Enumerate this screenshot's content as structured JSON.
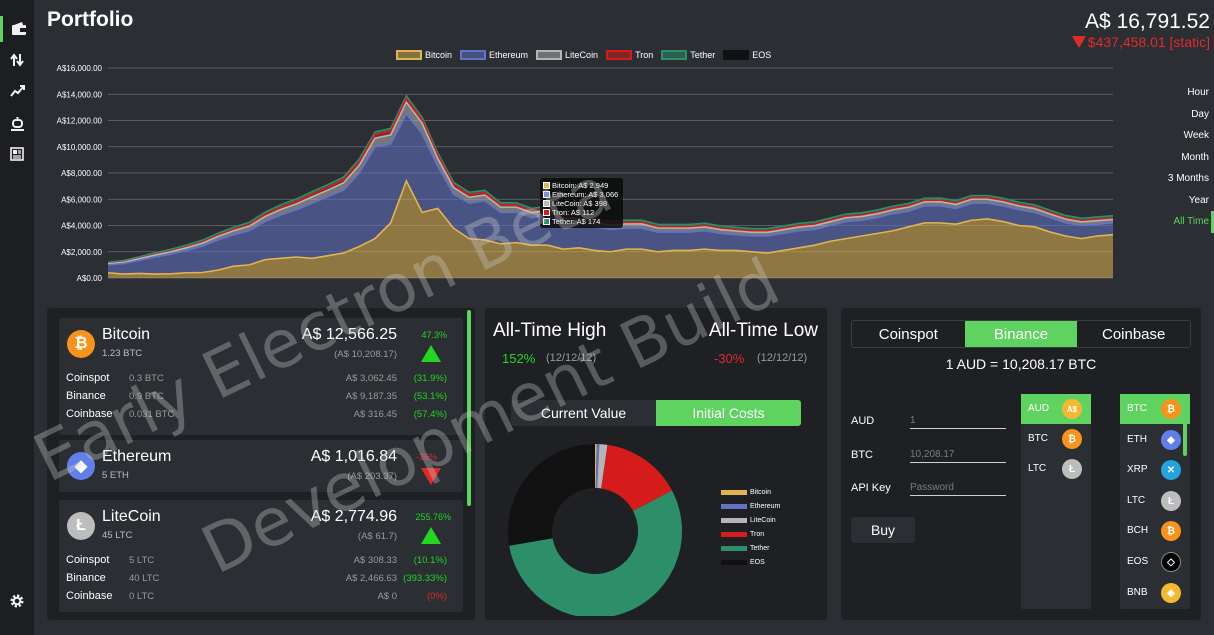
{
  "header": {
    "title": "Portfolio",
    "total_value": "A$ 16,791.52",
    "total_change": "$437,458.01 [static]"
  },
  "nav": {
    "items": [
      "wallet-icon",
      "transfer-icon",
      "trend-icon",
      "bot-icon",
      "news-icon"
    ],
    "settings_icon": "gear-icon"
  },
  "chart_legend": [
    {
      "name": "Bitcoin",
      "color": "#e0b550"
    },
    {
      "name": "Ethereum",
      "color": "#6273c7"
    },
    {
      "name": "LiteCoin",
      "color": "#b5b5b5"
    },
    {
      "name": "Tron",
      "color": "#d61b1b"
    },
    {
      "name": "Tether",
      "color": "#2d8f6a"
    },
    {
      "name": "EOS",
      "color": "#111111"
    }
  ],
  "chart_data": {
    "type": "area",
    "stacked": true,
    "yticks": [
      "A$0.00",
      "A$2,000.00",
      "A$4,000.00",
      "A$6,000.00",
      "A$8,000.00",
      "A$10,000.00",
      "A$12,000.00",
      "A$14,000.00",
      "A$16,000.00"
    ],
    "ylim": [
      0,
      16000
    ],
    "grid": true,
    "legend": "top-center",
    "series": [
      {
        "name": "Bitcoin",
        "values": [
          400,
          300,
          350,
          300,
          320,
          400,
          420,
          600,
          900,
          1000,
          1400,
          1500,
          1600,
          1500,
          1700,
          1900,
          2400,
          3000,
          4200,
          7400,
          5000,
          5300,
          3800,
          3000,
          2900,
          2600,
          2700,
          2500,
          2500,
          2200,
          2300,
          2100,
          2000,
          2200,
          2200,
          2000,
          2100,
          2100,
          2200,
          2100,
          2100,
          2000,
          1900,
          2100,
          2300,
          2500,
          2800,
          3000,
          3200,
          3400,
          3600,
          3900,
          4200,
          4200,
          4100,
          4400,
          4500,
          4300,
          4000,
          3900,
          3500,
          3200,
          3000,
          3200,
          3300
        ]
      },
      {
        "name": "Ethereum",
        "values": [
          600,
          800,
          1000,
          1300,
          1500,
          1700,
          2000,
          2300,
          2400,
          2600,
          2900,
          3300,
          3600,
          4200,
          4500,
          4800,
          5600,
          7000,
          6000,
          5100,
          6000,
          3200,
          2600,
          2700,
          3000,
          2400,
          2300,
          2100,
          2300,
          2000,
          1900,
          1800,
          1700,
          1600,
          1600,
          1500,
          1400,
          1400,
          1400,
          1300,
          1200,
          1200,
          1300,
          1300,
          1300,
          1200,
          1200,
          1300,
          1200,
          1200,
          1300,
          1200,
          1300,
          1300,
          1200,
          1300,
          1200,
          1200,
          1200,
          1100,
          1100,
          1000,
          1000,
          900,
          900
        ]
      },
      {
        "name": "LiteCoin",
        "values": [
          80,
          100,
          120,
          150,
          180,
          200,
          230,
          260,
          300,
          350,
          380,
          420,
          450,
          480,
          500,
          550,
          600,
          650,
          700,
          900,
          800,
          600,
          500,
          450,
          420,
          400,
          400,
          380,
          380,
          360,
          350,
          340,
          330,
          320,
          320,
          310,
          300,
          300,
          290,
          290,
          280,
          280,
          280,
          280,
          280,
          290,
          290,
          290,
          290,
          300,
          300,
          300,
          300,
          310,
          310,
          300,
          300,
          300,
          290,
          290,
          280,
          280,
          270,
          270,
          260
        ]
      },
      {
        "name": "Tron",
        "values": [
          20,
          30,
          40,
          50,
          60,
          70,
          80,
          90,
          100,
          120,
          140,
          160,
          180,
          200,
          220,
          240,
          260,
          280,
          300,
          280,
          260,
          240,
          220,
          200,
          180,
          160,
          150,
          140,
          130,
          120,
          110,
          110,
          110,
          110,
          110,
          110,
          110,
          110,
          110,
          110,
          110,
          110,
          110,
          110,
          110,
          110,
          110,
          110,
          110,
          110,
          110,
          110,
          110,
          110,
          110,
          110,
          110,
          110,
          110,
          110,
          110,
          110,
          110,
          110,
          110
        ]
      },
      {
        "name": "Tether",
        "values": [
          100,
          110,
          110,
          120,
          130,
          140,
          150,
          160,
          170,
          180,
          190,
          200,
          200,
          200,
          200,
          200,
          200,
          200,
          200,
          200,
          190,
          190,
          180,
          180,
          180,
          180,
          180,
          180,
          175,
          175,
          175,
          175,
          175,
          175,
          175,
          175,
          175,
          175,
          175,
          175,
          175,
          175,
          175,
          175,
          175,
          175,
          175,
          175,
          175,
          175,
          175,
          175,
          175,
          175,
          175,
          175,
          175,
          175,
          175,
          175,
          175,
          175,
          175,
          175,
          175
        ]
      },
      {
        "name": "EOS",
        "values": [
          0,
          0,
          0,
          0,
          0,
          0,
          0,
          0,
          0,
          0,
          0,
          0,
          0,
          0,
          0,
          0,
          0,
          0,
          0,
          0,
          0,
          0,
          0,
          0,
          0,
          0,
          0,
          0,
          0,
          0,
          0,
          0,
          0,
          0,
          0,
          0,
          0,
          0,
          0,
          0,
          0,
          0,
          0,
          0,
          0,
          0,
          0,
          0,
          0,
          0,
          0,
          0,
          0,
          0,
          0,
          0,
          0,
          0,
          0,
          0,
          0,
          0,
          0,
          0,
          0
        ]
      }
    ]
  },
  "tooltip": {
    "rows": [
      {
        "label": "Bitcoin: A$ 2,949",
        "color": "#e0b550"
      },
      {
        "label": "Ethereum: A$ 3,066",
        "color": "#6273c7"
      },
      {
        "label": "LiteCoin: A$ 398",
        "color": "#b5b5b5"
      },
      {
        "label": "Tron: A$ 112",
        "color": "#d61b1b"
      },
      {
        "label": "Tether: A$ 174",
        "color": "#2d8f6a"
      }
    ]
  },
  "ranges": [
    "Hour",
    "Day",
    "Week",
    "Month",
    "3 Months",
    "Year",
    "All Time"
  ],
  "holdings": {
    "coins": [
      {
        "name": "Bitcoin",
        "amount": "1.23 BTC",
        "value": "A$ 12,566.25",
        "sub": "(A$ 10,208.17)",
        "pct": "47.3%",
        "color": "#f7931a",
        "symbol": "₿",
        "exchanges": [
          {
            "name": "Coinspot",
            "amt": "0.3 BTC",
            "val": "A$ 3,062.45",
            "pct": "(31.9%)"
          },
          {
            "name": "Binance",
            "amt": "0.9 BTC",
            "val": "A$ 9,187.35",
            "pct": "(53.1%)"
          },
          {
            "name": "Coinbase",
            "amt": "0.031 BTC",
            "val": "A$ 316.45",
            "pct": "(57.4%)"
          }
        ]
      },
      {
        "name": "Ethereum",
        "amount": "5 ETH",
        "value": "A$ 1,016.84",
        "sub": "(A$ 203.37)",
        "pct": "-36%",
        "color": "#627eea",
        "symbol": "◆"
      },
      {
        "name": "LiteCoin",
        "amount": "45 LTC",
        "value": "A$ 2,774.96",
        "sub": "(A$ 61.7)",
        "pct": "255.76%",
        "color": "#bdbdbd",
        "symbol": "Ł",
        "exchanges": [
          {
            "name": "Coinspot",
            "amt": "5 LTC",
            "val": "A$ 308.33",
            "pct": "(10.1%)"
          },
          {
            "name": "Binance",
            "amt": "40 LTC",
            "val": "A$ 2,466.63",
            "pct": "(393.33%)"
          },
          {
            "name": "Coinbase",
            "amt": "0 LTC",
            "val": "A$ 0",
            "pct": "(0%)"
          }
        ]
      }
    ]
  },
  "stats": {
    "ath_label": "All-Time High",
    "atl_label": "All-Time Low",
    "ath_pct": "152%",
    "ath_date": "(12/12/12)",
    "atl_pct": "-30%",
    "atl_date": "(12/12/12)",
    "toggle": [
      "Current Value",
      "Initial Costs"
    ]
  },
  "donut_data": {
    "type": "pie",
    "labels": [
      "Bitcoin",
      "Ethereum",
      "LiteCoin",
      "Tron",
      "Tether",
      "EOS"
    ],
    "colors": [
      "#e0b550",
      "#6273c7",
      "#b5b5b5",
      "#d61b1b",
      "#2d8f6a",
      "#111111"
    ],
    "values": [
      0.3,
      0.5,
      1.5,
      15,
      55,
      27.7
    ]
  },
  "exchange": {
    "tabs": [
      "Coinspot",
      "Binance",
      "Coinbase"
    ],
    "rate": "1 AUD = 10,208.17 BTC",
    "fields": [
      {
        "label": "AUD",
        "value": "1"
      },
      {
        "label": "BTC",
        "value": "10,208.17"
      },
      {
        "label": "API Key",
        "value": "Password"
      }
    ],
    "buy_label": "Buy",
    "from_list": [
      {
        "label": "AUD",
        "icon": "A$",
        "color": "#f7b731"
      },
      {
        "label": "BTC",
        "icon": "₿",
        "color": "#f7931a"
      },
      {
        "label": "LTC",
        "icon": "Ł",
        "color": "#bdbdbd"
      }
    ],
    "to_list": [
      {
        "label": "BTC",
        "icon": "₿",
        "color": "#f7931a"
      },
      {
        "label": "ETH",
        "icon": "◆",
        "color": "#627eea"
      },
      {
        "label": "XRP",
        "icon": "✕",
        "color": "#23a3e0"
      },
      {
        "label": "LTC",
        "icon": "Ł",
        "color": "#bdbdbd"
      },
      {
        "label": "BCH",
        "icon": "₿",
        "color": "#f7931a"
      },
      {
        "label": "EOS",
        "icon": "◇",
        "color": "#000000"
      },
      {
        "label": "BNB",
        "icon": "◈",
        "color": "#f3ba2f"
      }
    ]
  },
  "watermark": [
    "Early Electron Beta",
    "Development Build"
  ]
}
